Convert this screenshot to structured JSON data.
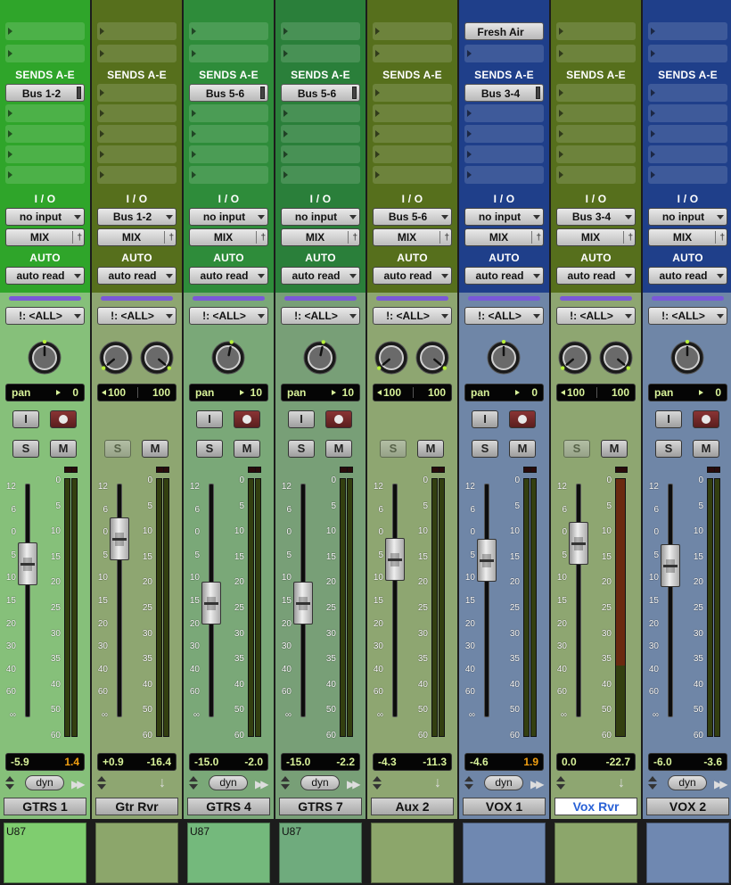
{
  "sections": {
    "sends": "SENDS A-E",
    "io": "I / O",
    "auto": "AUTO"
  },
  "scale": {
    "fader": [
      "12",
      "6",
      "0",
      "5",
      "10",
      "15",
      "20",
      "30",
      "40",
      "60",
      "∞"
    ],
    "meter": [
      "0",
      "5",
      "10",
      "15",
      "20",
      "25",
      "30",
      "35",
      "40",
      "50",
      "60"
    ]
  },
  "strips": [
    {
      "name": "GTRS 1",
      "selected": false,
      "top_color": "#2fa52a",
      "mid_color": "#86c07a",
      "bot_color": "#7fcd6f",
      "inserts": [],
      "sends": [
        "Bus 1-2",
        "",
        "",
        "",
        ""
      ],
      "input": "no input",
      "output": "MIX",
      "automation": "auto read",
      "group": "!: <ALL>",
      "pan": {
        "type": "mono",
        "left": "pan",
        "right": "0",
        "angles": [
          0
        ]
      },
      "rec_visible": true,
      "solo_dim": false,
      "volume": "-5.9",
      "peak": "1.4",
      "peak_warn": true,
      "fader_value": 0.343,
      "meter": {
        "type": "stereo",
        "levels": [
          0,
          0
        ]
      },
      "footer": "dyn",
      "comment": "U87"
    },
    {
      "name": "Gtr Rvr",
      "selected": false,
      "top_color": "#566f1c",
      "mid_color": "#8ea671",
      "bot_color": "#8ca66b",
      "inserts": [],
      "sends": [
        "",
        "",
        "",
        "",
        ""
      ],
      "input": "Bus 1-2",
      "output": "MIX",
      "automation": "auto read",
      "group": "!: <ALL>",
      "pan": {
        "type": "stereo",
        "left": "100",
        "right": "100",
        "angles": [
          -130,
          130
        ]
      },
      "rec_visible": false,
      "solo_dim": true,
      "volume": "+0.9",
      "peak": "-16.4",
      "peak_warn": false,
      "fader_value": 0.237,
      "meter": {
        "type": "stereo",
        "levels": [
          0,
          0
        ]
      },
      "footer": "arrow",
      "comment": ""
    },
    {
      "name": "GTRS 4",
      "selected": false,
      "top_color": "#2e8c3a",
      "mid_color": "#7aa878",
      "bot_color": "#74b97c",
      "inserts": [],
      "sends": [
        "Bus 5-6",
        "",
        "",
        "",
        ""
      ],
      "input": "no input",
      "output": "MIX",
      "automation": "auto read",
      "group": "!: <ALL>",
      "pan": {
        "type": "mono",
        "left": "pan",
        "right": "10",
        "angles": [
          12
        ]
      },
      "rec_visible": true,
      "solo_dim": false,
      "volume": "-15.0",
      "peak": "-2.0",
      "peak_warn": false,
      "fader_value": 0.51,
      "meter": {
        "type": "stereo",
        "levels": [
          0,
          0
        ]
      },
      "footer": "dyn",
      "comment": "U87"
    },
    {
      "name": "GTRS  7",
      "selected": false,
      "top_color": "#2a7f3a",
      "mid_color": "#789f77",
      "bot_color": "#6fab7d",
      "inserts": [],
      "sends": [
        "Bus 5-6",
        "",
        "",
        "",
        ""
      ],
      "input": "no input",
      "output": "MIX",
      "automation": "auto read",
      "group": "!: <ALL>",
      "pan": {
        "type": "mono",
        "left": "pan",
        "right": "10",
        "angles": [
          12
        ]
      },
      "rec_visible": true,
      "solo_dim": false,
      "volume": "-15.0",
      "peak": "-2.2",
      "peak_warn": false,
      "fader_value": 0.51,
      "meter": {
        "type": "stereo",
        "levels": [
          0,
          0
        ]
      },
      "footer": "dyn",
      "comment": "U87"
    },
    {
      "name": "Aux 2",
      "selected": false,
      "top_color": "#566f1c",
      "mid_color": "#8ea671",
      "bot_color": "#8ca66b",
      "inserts": [],
      "sends": [
        "",
        "",
        "",
        "",
        ""
      ],
      "input": "Bus 5-6",
      "output": "MIX",
      "automation": "auto read",
      "group": "!: <ALL>",
      "pan": {
        "type": "stereo",
        "left": "100",
        "right": "100",
        "angles": [
          -130,
          130
        ]
      },
      "rec_visible": false,
      "solo_dim": true,
      "volume": "-4.3",
      "peak": "-11.3",
      "peak_warn": false,
      "fader_value": 0.325,
      "meter": {
        "type": "stereo",
        "levels": [
          0,
          0
        ]
      },
      "footer": "arrow",
      "comment": ""
    },
    {
      "name": "VOX 1",
      "selected": false,
      "top_color": "#1f3f8a",
      "mid_color": "#6f86a7",
      "bot_color": "#6f88b1",
      "inserts": [
        "Fresh Air"
      ],
      "sends": [
        "Bus 3-4",
        "",
        "",
        "",
        ""
      ],
      "input": "no input",
      "output": "MIX",
      "automation": "auto read",
      "group": "!: <ALL>",
      "pan": {
        "type": "mono",
        "left": "pan",
        "right": "0",
        "angles": [
          0
        ]
      },
      "rec_visible": true,
      "solo_dim": false,
      "volume": "-4.6",
      "peak": "1.9",
      "peak_warn": true,
      "fader_value": 0.33,
      "meter": {
        "type": "stereo",
        "levels": [
          0,
          0
        ]
      },
      "footer": "dyn",
      "comment": ""
    },
    {
      "name": "Vox Rvr",
      "selected": true,
      "top_color": "#566f1c",
      "mid_color": "#8ea671",
      "bot_color": "#8ca66b",
      "inserts": [],
      "sends": [
        "",
        "",
        "",
        "",
        ""
      ],
      "input": "Bus 3-4",
      "output": "MIX",
      "automation": "auto read",
      "group": "!: <ALL>",
      "pan": {
        "type": "stereo",
        "left": "100",
        "right": "100",
        "angles": [
          -130,
          130
        ]
      },
      "rec_visible": false,
      "solo_dim": true,
      "volume": "0.0",
      "peak": "-22.7",
      "peak_warn": false,
      "fader_value": 0.254,
      "meter": {
        "type": "mono",
        "levels": [
          0.72
        ]
      },
      "footer": "arrow",
      "comment": ""
    },
    {
      "name": "VOX 2",
      "selected": false,
      "top_color": "#1f3f8a",
      "mid_color": "#6f86a7",
      "bot_color": "#6f88b1",
      "inserts": [],
      "sends": [
        "",
        "",
        "",
        "",
        ""
      ],
      "input": "no input",
      "output": "MIX",
      "automation": "auto read",
      "group": "!: <ALL>",
      "pan": {
        "type": "mono",
        "left": "pan",
        "right": "0",
        "angles": [
          0
        ]
      },
      "rec_visible": true,
      "solo_dim": false,
      "volume": "-6.0",
      "peak": "-3.6",
      "peak_warn": false,
      "fader_value": 0.35,
      "meter": {
        "type": "stereo",
        "levels": [
          0,
          0
        ]
      },
      "footer": "dyn",
      "comment": ""
    }
  ]
}
